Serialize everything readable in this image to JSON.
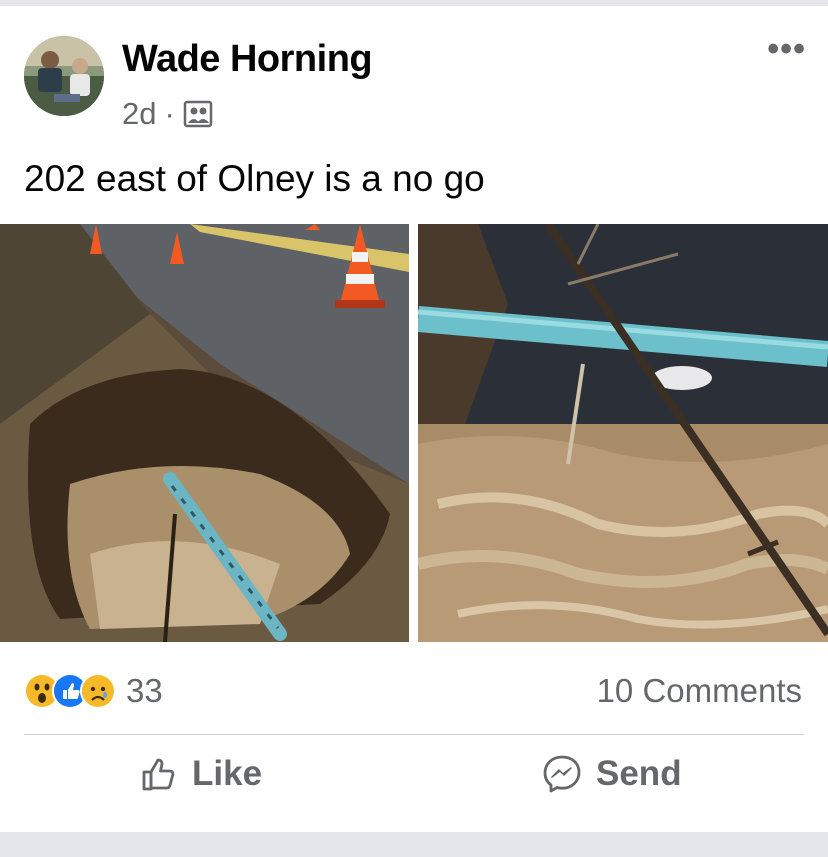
{
  "post": {
    "author": "Wade Horning",
    "timestamp": "2d",
    "separator": "·",
    "audience_icon": "friends-icon",
    "more_label": "•••",
    "text": "202 east of Olney is a no go"
  },
  "footer": {
    "reactions": [
      "wow",
      "like",
      "sad"
    ],
    "reaction_count": "33",
    "comments_label": "10 Comments"
  },
  "actions": {
    "like_label": "Like",
    "send_label": "Send"
  },
  "colors": {
    "like_blue": "#1877f2",
    "emoji_yellow": "#f7b928",
    "text_secondary": "#65676b"
  }
}
